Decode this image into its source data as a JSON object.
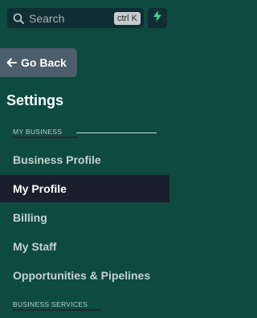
{
  "search": {
    "placeholder": "Search",
    "shortcut": "ctrl K"
  },
  "quick_action": {
    "icon": "bolt-icon",
    "color": "#3ddc84"
  },
  "back": {
    "label": "Go Back"
  },
  "settings": {
    "title": "Settings"
  },
  "sections": {
    "my_business": "MY BUSINESS",
    "business_services": "BUSINESS SERVICES"
  },
  "nav": {
    "items": [
      {
        "label": "Business Profile",
        "active": false
      },
      {
        "label": "My Profile",
        "active": true
      },
      {
        "label": "Billing",
        "active": false
      },
      {
        "label": "My Staff",
        "active": false
      },
      {
        "label": "Opportunities & Pipelines",
        "active": false
      }
    ]
  },
  "colors": {
    "background": "#0d4a40",
    "active_item": "#1a1f2e",
    "back_button": "#4c5d6b"
  }
}
